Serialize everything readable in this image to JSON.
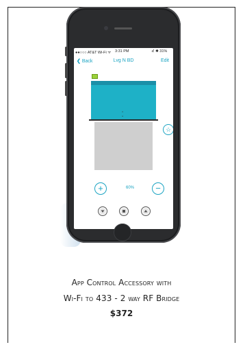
{
  "status_bar": {
    "carrier": "●●○○○ AT&T Wi-Fi ᯤ",
    "time": "3:31 PM",
    "battery": "⊀ ✱ 31%"
  },
  "nav": {
    "back_label": "Back",
    "title": "Lvg N BD",
    "edit_label": "Edit"
  },
  "controls": {
    "position_percent": "60%",
    "position_value": 0.6,
    "plus_symbol": "+",
    "minus_symbol": "−",
    "star_symbol": "☆"
  },
  "product": {
    "name_line1": "App Control Accessory with",
    "name_line2": "Wi-Fi to 433 - 2 way RF Bridge",
    "price": "$372"
  },
  "colors": {
    "accent": "#1aa3c2",
    "fabric": "#1eb1c7",
    "rail": "#1a8fa8",
    "battery": "#9bd23a"
  }
}
